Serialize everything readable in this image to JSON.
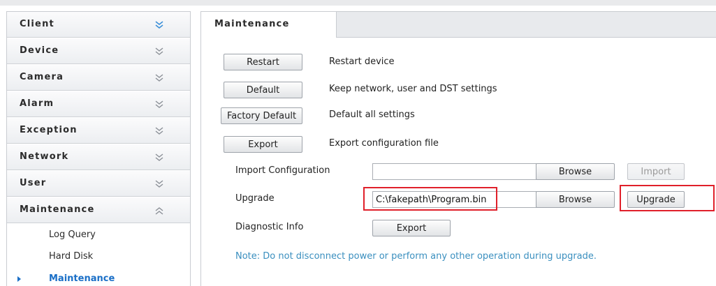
{
  "sidebar": {
    "items": [
      {
        "label": "Client",
        "state": "collapsed"
      },
      {
        "label": "Device",
        "state": "collapsed"
      },
      {
        "label": "Camera",
        "state": "collapsed"
      },
      {
        "label": "Alarm",
        "state": "collapsed"
      },
      {
        "label": "Exception",
        "state": "collapsed"
      },
      {
        "label": "Network",
        "state": "collapsed"
      },
      {
        "label": "User",
        "state": "collapsed"
      },
      {
        "label": "Maintenance",
        "state": "expanded"
      }
    ],
    "subitems": [
      {
        "label": "Log Query"
      },
      {
        "label": "Hard Disk"
      },
      {
        "label": "Maintenance",
        "active": true
      }
    ]
  },
  "main": {
    "tab_label": "Maintenance",
    "actions": [
      {
        "button": "Restart",
        "description": "Restart device"
      },
      {
        "button": "Default",
        "description": "Keep network, user and DST settings"
      },
      {
        "button": "Factory Default",
        "description": "Default all settings"
      },
      {
        "button": "Export",
        "description": "Export configuration file"
      }
    ],
    "import_config": {
      "label": "Import Configuration",
      "value": "",
      "browse": "Browse",
      "action": "Import",
      "action_disabled": true
    },
    "upgrade": {
      "label": "Upgrade",
      "value": "C:\\fakepath\\Program.bin",
      "browse": "Browse",
      "action": "Upgrade"
    },
    "diagnostic": {
      "label": "Diagnostic Info",
      "button": "Export"
    },
    "note": "Note: Do not disconnect power or perform any other operation during upgrade."
  },
  "colors": {
    "accent": "#1a6fc7",
    "note": "#3a8fbf",
    "highlight": "#e0202a",
    "chevron": "#8a8f96",
    "chevron_first": "#3b8fd8"
  }
}
